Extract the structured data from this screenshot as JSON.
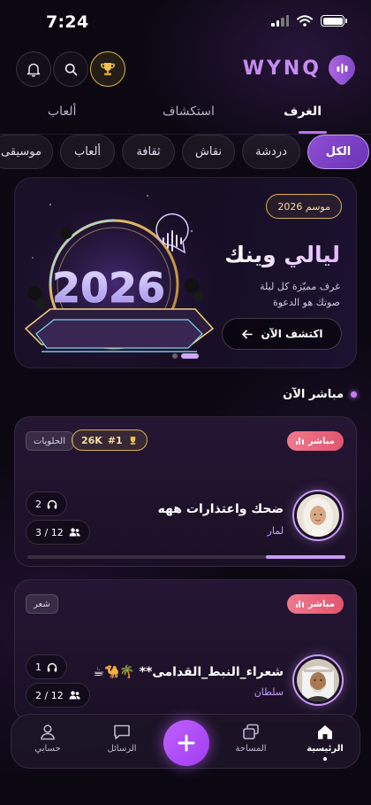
{
  "status_bar": {
    "time": "7:24"
  },
  "header": {
    "logo_text": "WYNQ"
  },
  "main_tabs": [
    {
      "label": "الغرف"
    },
    {
      "label": "استكشاف"
    },
    {
      "label": "ألعاب"
    }
  ],
  "chips": [
    {
      "label": "الكل"
    },
    {
      "label": "دردشة"
    },
    {
      "label": "نقاش"
    },
    {
      "label": "ثقافة"
    },
    {
      "label": "ألعاب"
    },
    {
      "label": "موسيقى"
    }
  ],
  "banner": {
    "season": "موسم 2026",
    "title": "ليالي وينك",
    "subtitle_line1": "غرف مميّزة كل ليلة",
    "subtitle_line2": "صوتك هو الدعوة",
    "cta": "اكتشف الآن",
    "art_text": "2026"
  },
  "live_section": {
    "title": "مباشر الآن"
  },
  "rooms": [
    {
      "live_label": "مباشر",
      "category": "الحلويات",
      "rank": "#1",
      "score": "26K",
      "title": "ضحك واعتذارات ههه",
      "host": "لمار",
      "listeners": "2",
      "seats": "3 / 12",
      "progress": 0.25
    },
    {
      "live_label": "مباشر",
      "category": "شعر",
      "title": "شعراء_النبط_القدامى** 🌴🐪☕",
      "host": "سلطان",
      "listeners": "1",
      "seats": "2 / 12"
    }
  ],
  "bottom_nav": [
    {
      "label": "الرئيسية"
    },
    {
      "label": "المساحة"
    },
    {
      "label": "الرسائل"
    },
    {
      "label": "حسابي"
    }
  ],
  "colors": {
    "accent": "#b774f0",
    "gold": "#d8b24c",
    "live": "#e2556f",
    "background": "#0c0812"
  }
}
